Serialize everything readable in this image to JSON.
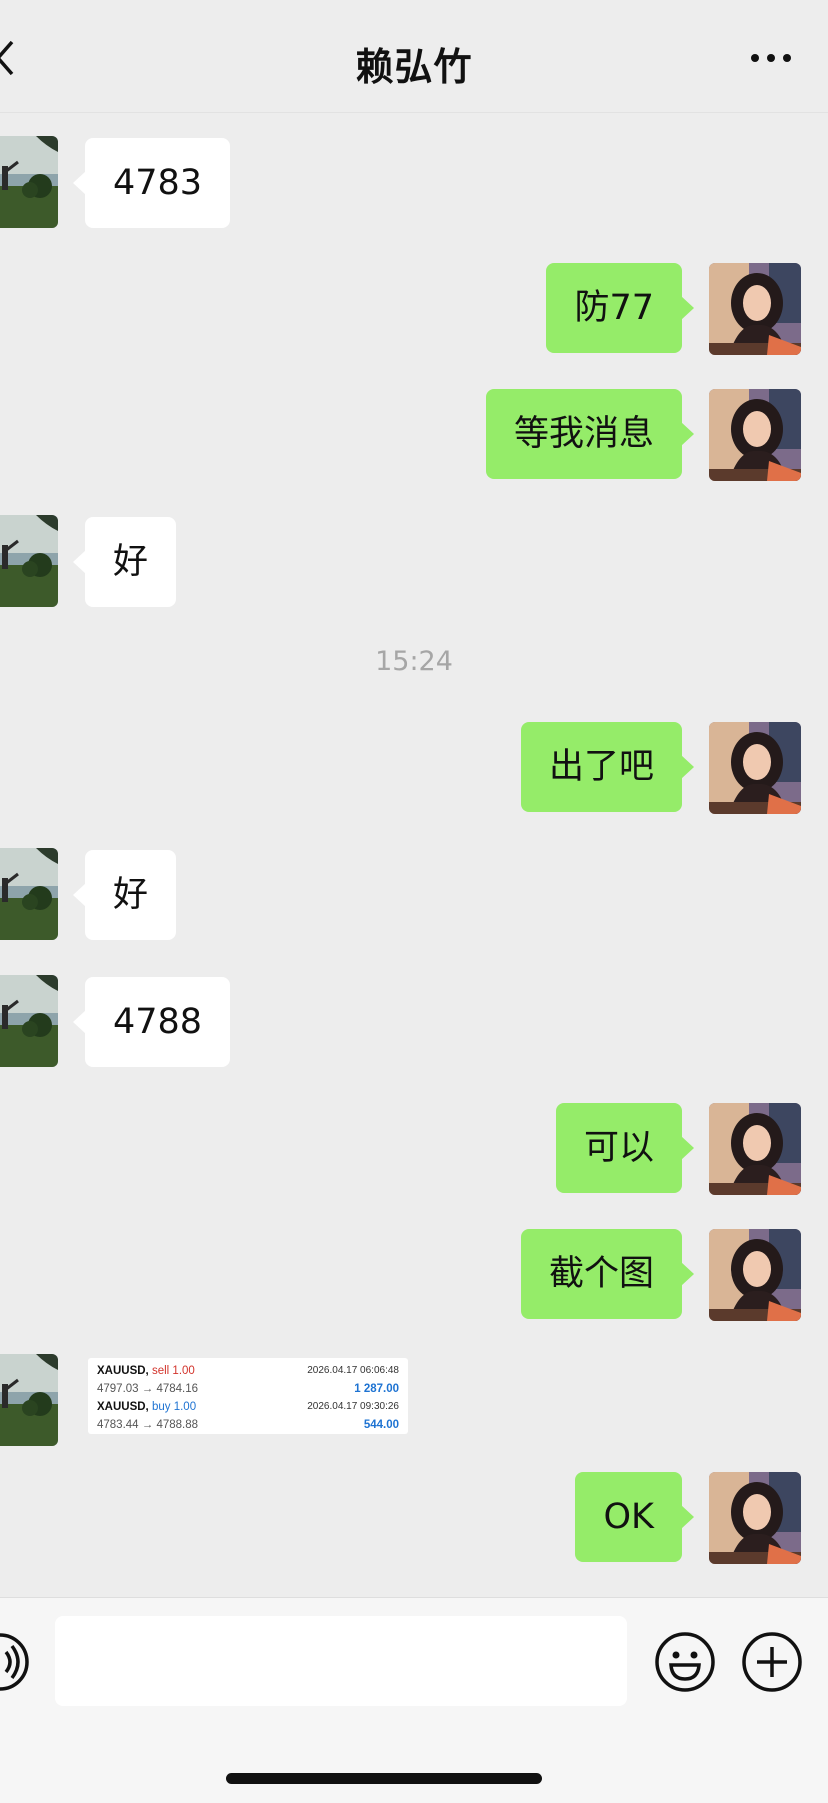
{
  "header": {
    "title": "赖弘竹",
    "back_icon": "chevron-left-icon",
    "more_icon": "more-dots-icon"
  },
  "messages": [
    {
      "side": "left",
      "text": "4783"
    },
    {
      "side": "right",
      "text": "防77"
    },
    {
      "side": "right",
      "text": "等我消息"
    },
    {
      "side": "left",
      "text": "好"
    },
    {
      "timestamp": "15:24"
    },
    {
      "side": "right",
      "text": "出了吧"
    },
    {
      "side": "left",
      "text": "好"
    },
    {
      "side": "left",
      "text": "4788"
    },
    {
      "side": "right",
      "text": "可以"
    },
    {
      "side": "right",
      "text": "截个图"
    },
    {
      "side": "left",
      "image": "trade_card"
    },
    {
      "side": "right",
      "text": "OK"
    }
  ],
  "trade_card": {
    "trades": [
      {
        "symbol": "XAUUSD,",
        "action": "sell 1.00",
        "time": "2026.04.17 06:06:48",
        "prices": "4797.03 → 4784.16",
        "profit": "1 287.00"
      },
      {
        "symbol": "XAUUSD,",
        "action": "buy 1.00",
        "time": "2026.04.17 09:30:26",
        "prices": "4783.44 → 4788.88",
        "profit": "544.00"
      }
    ]
  },
  "input_bar": {
    "value": "",
    "voice_icon": "voice-icon",
    "emoji_icon": "emoji-icon",
    "plus_icon": "plus-icon"
  },
  "colors": {
    "my_bubble": "#95ec69",
    "their_bubble": "#ffffff",
    "background": "#ededed"
  }
}
